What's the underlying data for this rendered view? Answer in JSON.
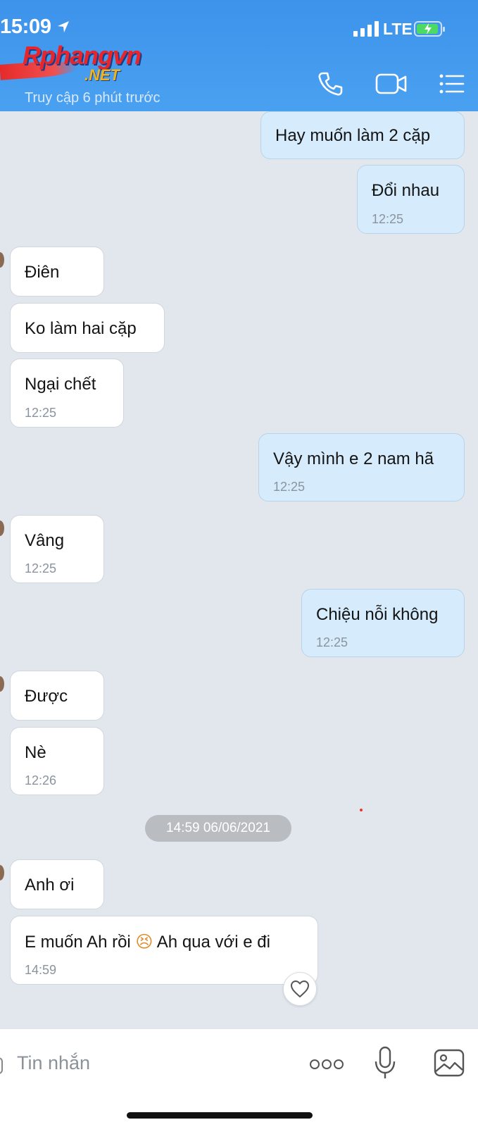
{
  "status_bar": {
    "time": "15:09",
    "network": "LTE"
  },
  "header": {
    "logo_main": "Rphangvn",
    "logo_suffix": ".NET",
    "last_seen": "Truy cập 6 phút trước",
    "icons": [
      "phone-icon",
      "video-call-icon",
      "menu-list-icon"
    ]
  },
  "messages": [
    {
      "from": "me",
      "text": "Hay muốn làm 2 cặp",
      "time": ""
    },
    {
      "from": "me",
      "text": "Đổi nhau",
      "time": "12:25"
    },
    {
      "from": "them",
      "text": "Điên",
      "time": ""
    },
    {
      "from": "them",
      "text": "Ko làm hai cặp",
      "time": ""
    },
    {
      "from": "them",
      "text": "Ngại chết",
      "time": "12:25"
    },
    {
      "from": "me",
      "text": "Vậy mình e 2 nam hã",
      "time": "12:25"
    },
    {
      "from": "them",
      "text": "Vâng",
      "time": "12:25"
    },
    {
      "from": "me",
      "text": "Chiệu nỗi không",
      "time": "12:25"
    },
    {
      "from": "them",
      "text": "Được",
      "time": ""
    },
    {
      "from": "them",
      "text": "Nè",
      "time": "12:26"
    },
    {
      "from": "them",
      "text": "Anh ơi",
      "time": ""
    },
    {
      "from": "them",
      "text": "E muốn Ah rồi",
      "text_after": "Ah qua với e đi",
      "emoji": "😣",
      "time": "14:59"
    }
  ],
  "date_separator": "14:59 06/06/2021",
  "composer": {
    "placeholder": "Tin nhắn",
    "icons": [
      "more-options-icon",
      "microphone-icon",
      "image-icon"
    ]
  }
}
